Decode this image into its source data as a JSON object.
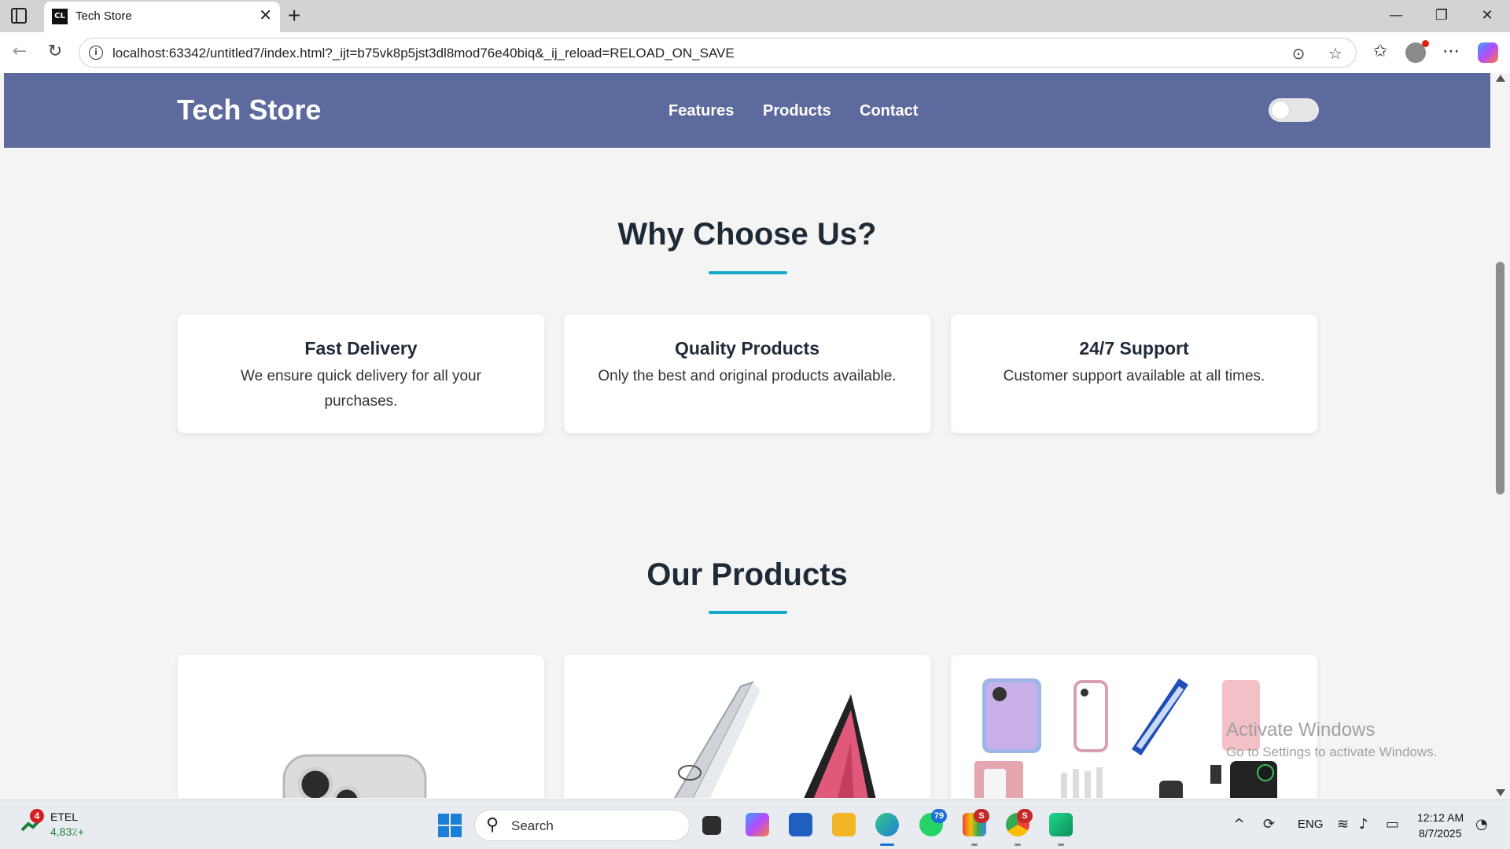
{
  "browser": {
    "tab_title": "Tech Store",
    "tab_favicon": "CL",
    "url": "localhost:63342/untitled7/index.html?_ijt=b75vk8p5jst3dl8mod76e40biq&_ij_reload=RELOAD_ON_SAVE",
    "window_controls": [
      "—",
      "❐",
      "✕"
    ]
  },
  "site": {
    "logo": "Tech Store",
    "nav": [
      "Features",
      "Products",
      "Contact"
    ],
    "header_color": "#5d6a9e",
    "accent_color": "#15a9c9",
    "dark_mode_toggle": "off"
  },
  "features": {
    "title": "Why Choose Us?",
    "cards": [
      {
        "title": "Fast Delivery",
        "text": "We ensure quick delivery for all your purchases."
      },
      {
        "title": "Quality Products",
        "text": "Only the best and original products available."
      },
      {
        "title": "24/7 Support",
        "text": "Customer support available at all times."
      }
    ]
  },
  "products": {
    "title": "Our Products",
    "cards": [
      {
        "image": "smartphone-image"
      },
      {
        "image": "laptop-image"
      },
      {
        "image": "phone-accessories-image"
      }
    ]
  },
  "watermark": {
    "title": "Activate Windows",
    "subtitle": "Go to Settings to activate Windows."
  },
  "taskbar": {
    "stock_badge": "4",
    "stock_name": "ETEL",
    "stock_change": "4,83٪+",
    "search_placeholder": "Search",
    "whatsapp_badge": "79",
    "gmail_badge": "S",
    "chrome_badge": "S",
    "language": "ENG",
    "time": "12:12 AM",
    "date": "8/7/2025"
  }
}
